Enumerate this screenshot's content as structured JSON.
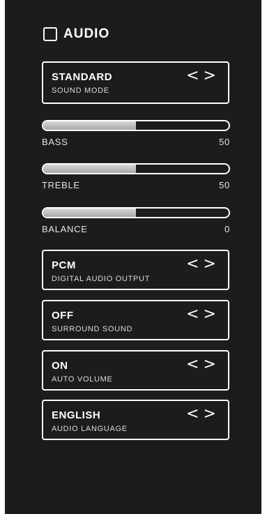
{
  "menu": {
    "title": "AUDIO",
    "title_icon": "checkbox-square-icon",
    "arrows": "<>"
  },
  "sound_mode": {
    "value": "STANDARD",
    "label": "SOUND MODE"
  },
  "sliders": [
    {
      "label": "BASS",
      "value": "50",
      "level": 0.5
    },
    {
      "label": "TREBLE",
      "value": "50",
      "level": 0.5
    },
    {
      "label": "BALANCE",
      "value": "0",
      "level": 0.5
    }
  ],
  "digital_audio_output": {
    "value": "PCM",
    "label": "DIGITAL AUDIO OUTPUT"
  },
  "surround_sound": {
    "value": "OFF",
    "label": "SURROUND SOUND"
  },
  "auto_volume": {
    "value": "ON",
    "label": "AUTO VOLUME"
  },
  "audio_language": {
    "value": "ENGLISH",
    "label": "AUDIO LANGUAGE"
  },
  "colors": {
    "background": "#1d1c1c",
    "foreground": "#ffffff",
    "slider_fill": "#b5b5b5"
  }
}
